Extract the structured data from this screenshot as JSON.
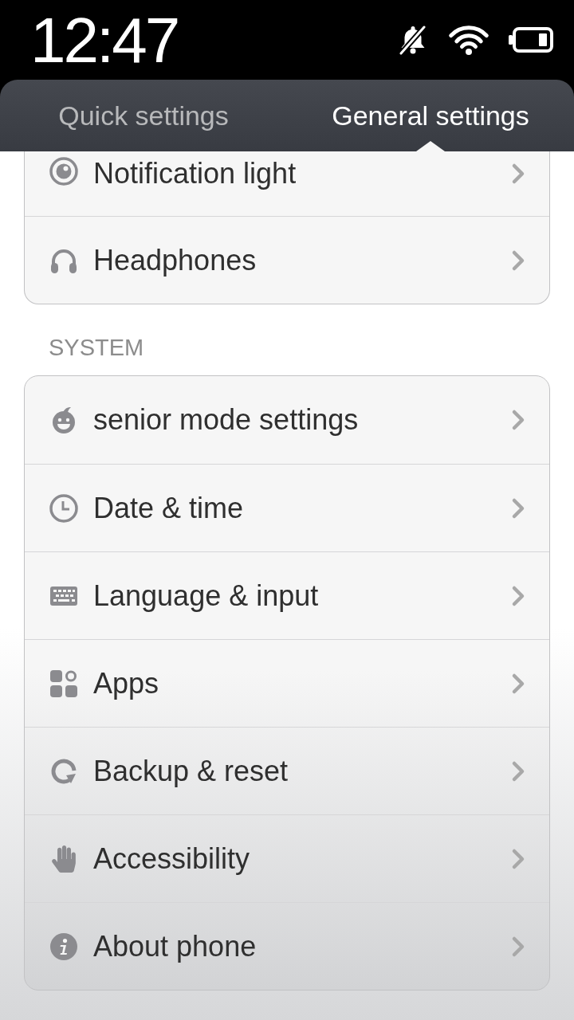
{
  "status_bar": {
    "time": "12:47"
  },
  "tabs": [
    {
      "label": "Quick settings",
      "selected": false
    },
    {
      "label": "General settings",
      "selected": true
    }
  ],
  "sections": [
    {
      "rows": [
        {
          "label": "Notification light"
        },
        {
          "label": "Headphones"
        }
      ]
    },
    {
      "header": "SYSTEM",
      "rows": [
        {
          "label": "senior mode settings"
        },
        {
          "label": "Date & time"
        },
        {
          "label": "Language & input"
        },
        {
          "label": "Apps"
        },
        {
          "label": "Backup & reset"
        },
        {
          "label": "Accessibility"
        },
        {
          "label": "About phone"
        }
      ]
    }
  ]
}
